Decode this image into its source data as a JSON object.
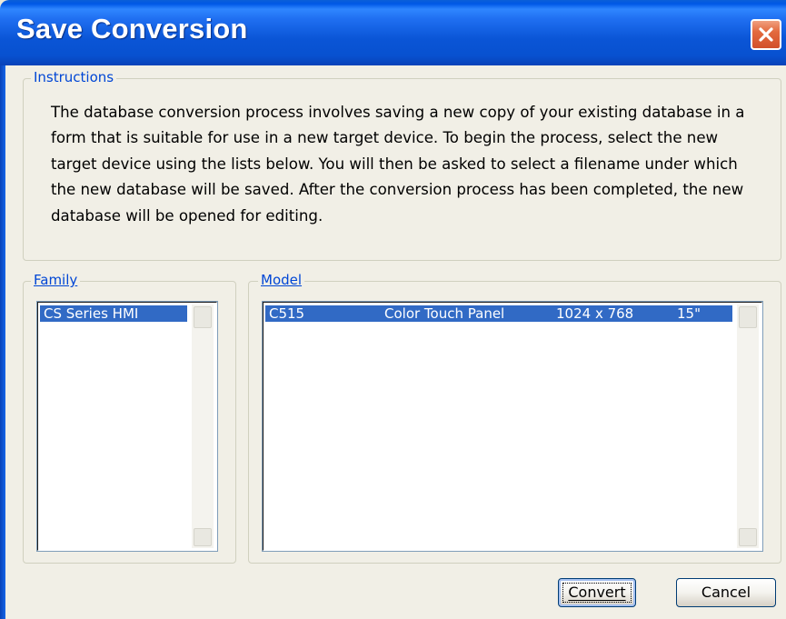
{
  "window": {
    "title": "Save Conversion",
    "close_icon": "close-x-icon",
    "title_color": "#0a55d6",
    "close_color": "#e36a3e"
  },
  "instructions": {
    "label": "Instructions",
    "text": "The database conversion process involves saving a new copy of your existing database in a form that is suitable for use in a new target device. To begin the process, select the new target device using the lists below. You will then be asked to select a filename under which the new database will be saved. After the conversion process has been completed, the new database will be opened for editing."
  },
  "family": {
    "label": "Family",
    "items": [
      "CS Series HMI"
    ],
    "selected_index": 0
  },
  "model": {
    "label": "Model",
    "rows": [
      {
        "name": "C515",
        "type": "Color Touch Panel",
        "resolution": "1024 x 768",
        "size": "15\""
      }
    ],
    "selected_index": 0
  },
  "buttons": {
    "convert": "Convert",
    "cancel": "Cancel"
  },
  "colors": {
    "selection": "#316ac5",
    "group_label": "#0046d5"
  }
}
